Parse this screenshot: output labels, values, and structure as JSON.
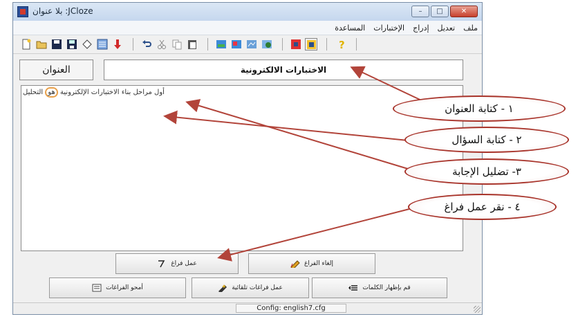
{
  "window": {
    "title": "بلا عنوان :JCloze"
  },
  "window_controls": {
    "minimize": "–",
    "maximize": "□",
    "close": "✕"
  },
  "menu": {
    "items": [
      "ملف",
      "تعديل",
      "إدراج",
      "الإختبارات",
      "المساعدة"
    ]
  },
  "toolbar": {
    "icons": [
      "new-file-icon",
      "open-folder-icon",
      "save-icon",
      "save-as-icon",
      "erase-icon",
      "web-page-icon",
      "down-arrow-icon",
      "undo-icon",
      "cut-icon",
      "copy-icon",
      "paste-icon",
      "web-export-icon",
      "web-export-2-icon",
      "web-export-3-icon",
      "web-export-4-icon",
      "config-icon",
      "options-icon",
      "help-icon"
    ]
  },
  "title_area": {
    "label": "العنوان",
    "value": "الاختبارات الالكترونية"
  },
  "editor": {
    "before": "التحليل",
    "gap": "هو",
    "after": " أول مراحل بناء الاختبارات الإلكترونية"
  },
  "buttons": {
    "make_gap": "عمل فراغ",
    "remove_gap": "إلغاء الفراغ",
    "show_words": "قم بإظهار الكلمات",
    "auto_gaps": "عمل فراغات تلقائية",
    "clear_gaps": "أمحو الفراغات"
  },
  "status": {
    "config": "Config: english7.cfg"
  },
  "callouts": [
    {
      "text": "١ - كتابة العنوان"
    },
    {
      "text": "٢ - كتابة السؤال"
    },
    {
      "text": "٣- تضليل الإجابة"
    },
    {
      "text": "٤ - نقر عمل فراغ"
    }
  ],
  "colors": {
    "callout_border": "#a8332a",
    "gap_highlight": "#e8a04a",
    "arrow": "#b2443a"
  }
}
